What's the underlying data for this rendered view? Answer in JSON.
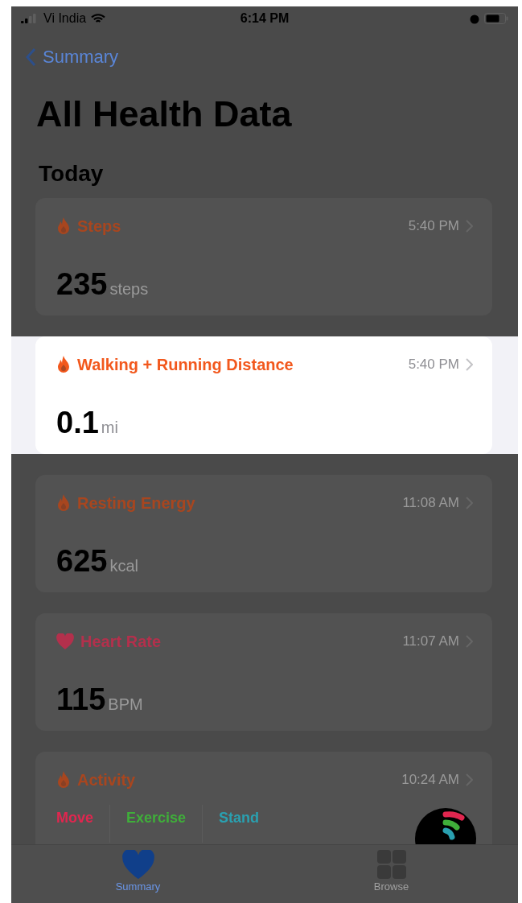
{
  "status_bar": {
    "carrier": "Vi India",
    "time": "6:14 PM"
  },
  "nav": {
    "back": "Summary"
  },
  "title": "All Health Data",
  "section": "Today",
  "cards": [
    {
      "kind": "flame",
      "color": "#a8461f",
      "title": "Steps",
      "time": "5:40 PM",
      "value": "235",
      "unit": "steps",
      "highlighted": false
    },
    {
      "kind": "flame",
      "color": "#f2581d",
      "title": "Walking + Running Distance",
      "time": "5:40 PM",
      "value": "0.1",
      "unit": "mi",
      "highlighted": true
    },
    {
      "kind": "flame",
      "color": "#a8461f",
      "title": "Resting Energy",
      "time": "11:08 AM",
      "value": "625",
      "unit": "kcal",
      "highlighted": false
    },
    {
      "kind": "heart",
      "color": "#b3304c",
      "title": "Heart Rate",
      "time": "11:07 AM",
      "value": "115",
      "unit": "BPM",
      "highlighted": false
    },
    {
      "kind": "activity",
      "color": "#a8461f",
      "title": "Activity",
      "time": "10:24 AM",
      "highlighted": false,
      "rings": [
        {
          "label": "Move",
          "color": "#e0264f"
        },
        {
          "label": "Exercise",
          "color": "#3fae3a"
        },
        {
          "label": "Stand",
          "color": "#2aa0b0"
        }
      ]
    }
  ],
  "tab_bar": [
    {
      "label": "Summary",
      "selected": true
    },
    {
      "label": "Browse",
      "selected": false
    }
  ]
}
